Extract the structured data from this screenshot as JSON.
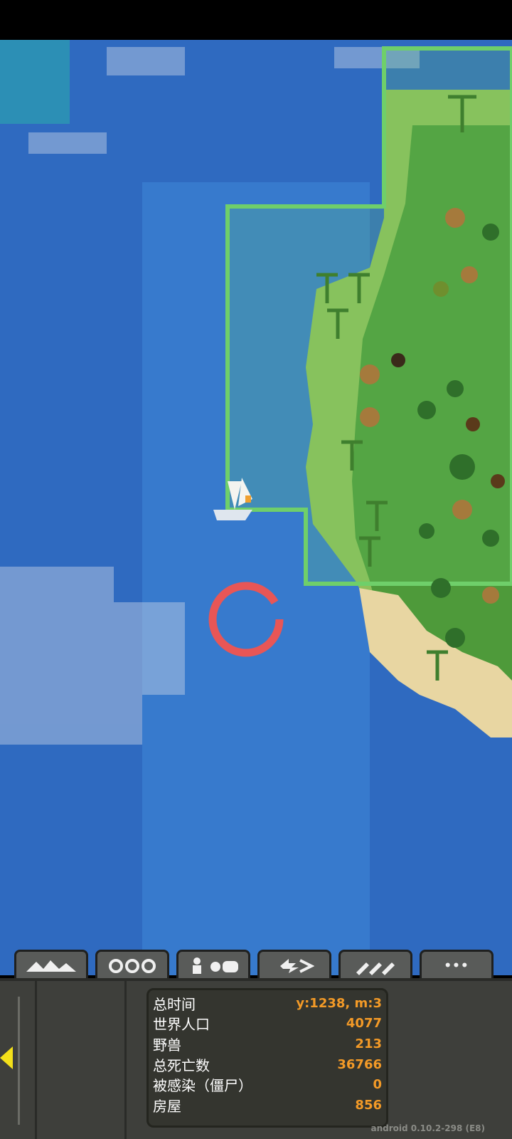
{
  "tabs": [
    {
      "name": "terrain",
      "icon": "mountains-icon"
    },
    {
      "name": "kingdoms",
      "icon": "faces-icon"
    },
    {
      "name": "creatures",
      "icon": "creatures-icon"
    },
    {
      "name": "powers",
      "icon": "lightning-swap-icon"
    },
    {
      "name": "tools",
      "icon": "bombs-icon"
    },
    {
      "name": "more",
      "label": "•••"
    }
  ],
  "stats": [
    {
      "label": "总时间",
      "value": "y:1238, m:3"
    },
    {
      "label": "世界人口",
      "value": "4077"
    },
    {
      "label": "野兽",
      "value": "213"
    },
    {
      "label": "总死亡数",
      "value": "36766"
    },
    {
      "label": "被感染（僵尸）",
      "value": "0"
    },
    {
      "label": "房屋",
      "value": "856"
    }
  ],
  "version": "android 0.10.2-298 (E8)",
  "colors": {
    "ocean_deep": "#2f6fc4",
    "ocean_shallow": "#3f86d6",
    "grass": "#6aa84f",
    "forest": "#3f7f2e",
    "sand": "#e5d4a0",
    "border": "#6fcf6a",
    "marker": "#e85656",
    "stat_value": "#f39a27"
  }
}
